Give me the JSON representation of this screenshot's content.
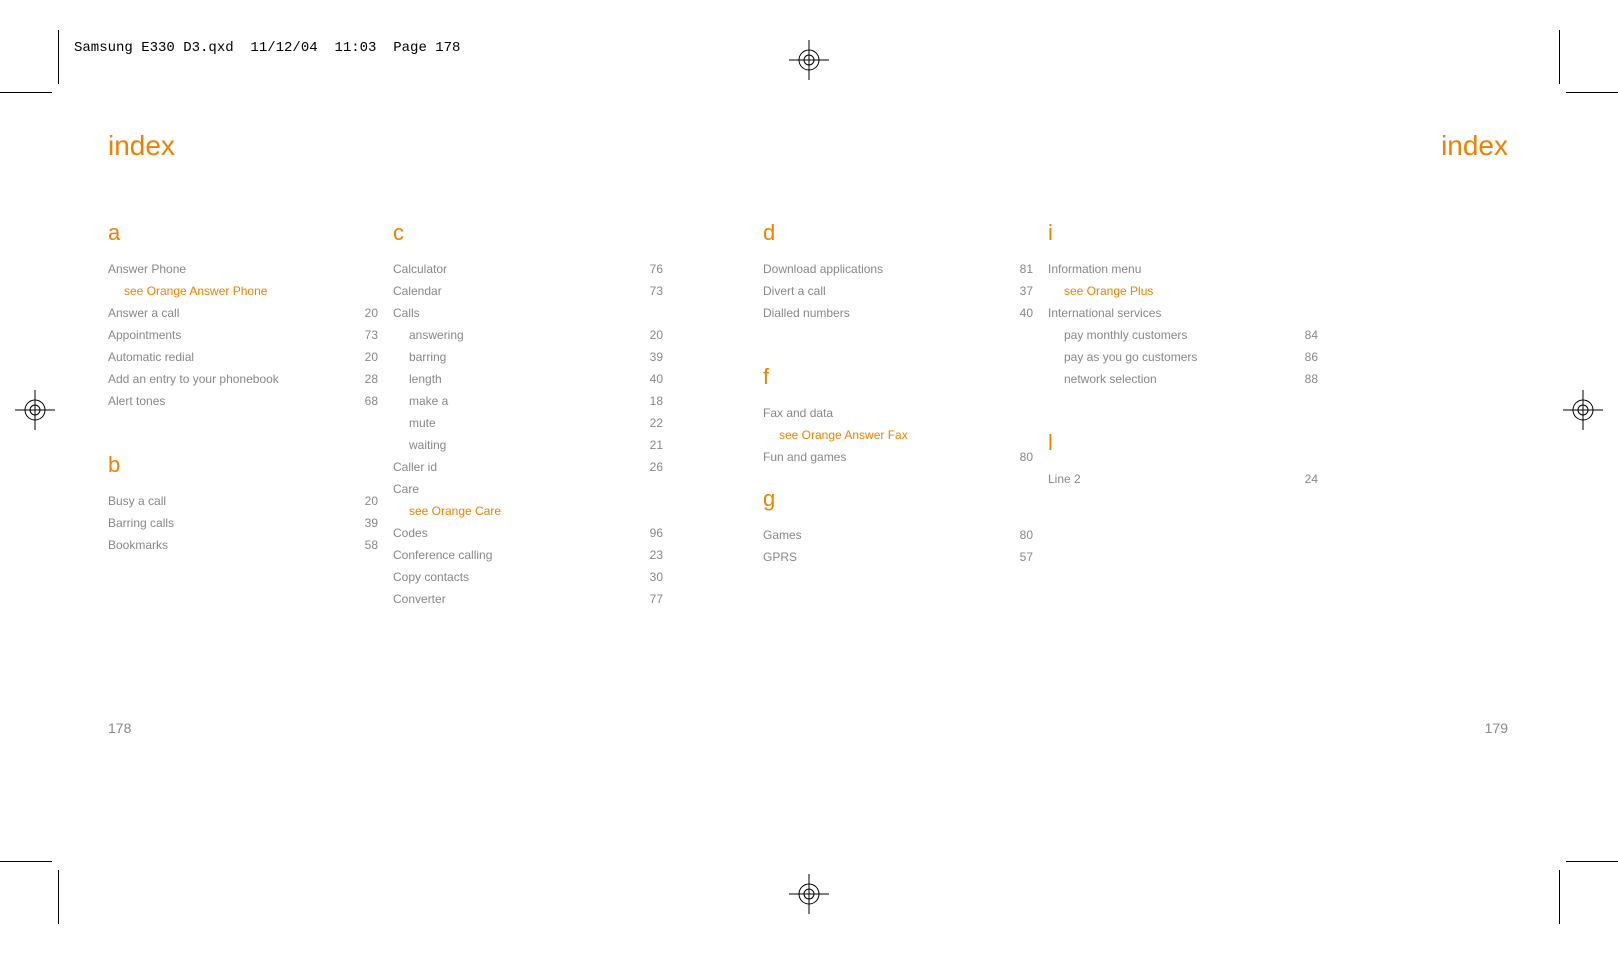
{
  "slug": "Samsung E330 D3.qxd  11/12/04  11:03  Page 178",
  "page_title_left": "index",
  "page_title_right": "index",
  "page_num_left": "178",
  "page_num_right": "179",
  "col1": {
    "a_letter": "a",
    "a_entries": [
      {
        "label": "Answer Phone",
        "pg": ""
      },
      {
        "label": "see Orange Answer Phone",
        "pg": "",
        "sub": true,
        "xref": true
      },
      {
        "label": "Answer a call",
        "pg": "20"
      },
      {
        "label": "Appointments",
        "pg": "73"
      },
      {
        "label": "Automatic redial",
        "pg": "20"
      },
      {
        "label": "Add an entry to your phonebook",
        "pg": "28"
      },
      {
        "label": "Alert tones",
        "pg": "68"
      }
    ],
    "b_letter": "b",
    "b_entries": [
      {
        "label": "Busy a call",
        "pg": "20"
      },
      {
        "label": "Barring calls",
        "pg": "39"
      },
      {
        "label": "Bookmarks",
        "pg": "58"
      }
    ]
  },
  "col2": {
    "c_letter": "c",
    "c_entries": [
      {
        "label": "Calculator",
        "pg": "76"
      },
      {
        "label": "Calendar",
        "pg": "73"
      },
      {
        "label": "Calls",
        "pg": ""
      },
      {
        "label": "answering",
        "pg": "20",
        "sub": true
      },
      {
        "label": "barring",
        "pg": "39",
        "sub": true
      },
      {
        "label": "length",
        "pg": "40",
        "sub": true
      },
      {
        "label": "make a",
        "pg": "18",
        "sub": true
      },
      {
        "label": "mute",
        "pg": "22",
        "sub": true
      },
      {
        "label": "waiting",
        "pg": "21",
        "sub": true
      },
      {
        "label": "Caller id",
        "pg": "26"
      },
      {
        "label": "Care",
        "pg": ""
      },
      {
        "label": "see Orange Care",
        "pg": "",
        "sub": true,
        "xref": true
      },
      {
        "label": "Codes",
        "pg": "96"
      },
      {
        "label": "Conference calling",
        "pg": "23"
      },
      {
        "label": "Copy contacts",
        "pg": "30"
      },
      {
        "label": "Converter",
        "pg": "77"
      }
    ]
  },
  "col3": {
    "d_letter": "d",
    "d_entries": [
      {
        "label": "Download applications",
        "pg": "81"
      },
      {
        "label": "Divert a call",
        "pg": "37"
      },
      {
        "label": "Dialled numbers",
        "pg": "40"
      }
    ],
    "f_letter": "f",
    "f_entries": [
      {
        "label": "Fax and data",
        "pg": ""
      },
      {
        "label": "see Orange Answer Fax",
        "pg": "",
        "sub": true,
        "xref": true
      },
      {
        "label": "Fun and games",
        "pg": "80"
      }
    ],
    "g_letter": "g",
    "g_entries": [
      {
        "label": "Games",
        "pg": "80"
      },
      {
        "label": "GPRS",
        "pg": "57"
      }
    ]
  },
  "col4": {
    "i_letter": "i",
    "i_entries": [
      {
        "label": "Information menu",
        "pg": ""
      },
      {
        "label": "see Orange Plus",
        "pg": "",
        "sub": true,
        "xref": true
      },
      {
        "label": "International services",
        "pg": ""
      },
      {
        "label": "pay monthly customers",
        "pg": "84",
        "sub": true
      },
      {
        "label": "pay as you go customers",
        "pg": "86",
        "sub": true
      },
      {
        "label": "network selection",
        "pg": "88",
        "sub": true
      }
    ],
    "l_letter": "l",
    "l_entries": [
      {
        "label": "Line 2",
        "pg": "24"
      }
    ]
  }
}
